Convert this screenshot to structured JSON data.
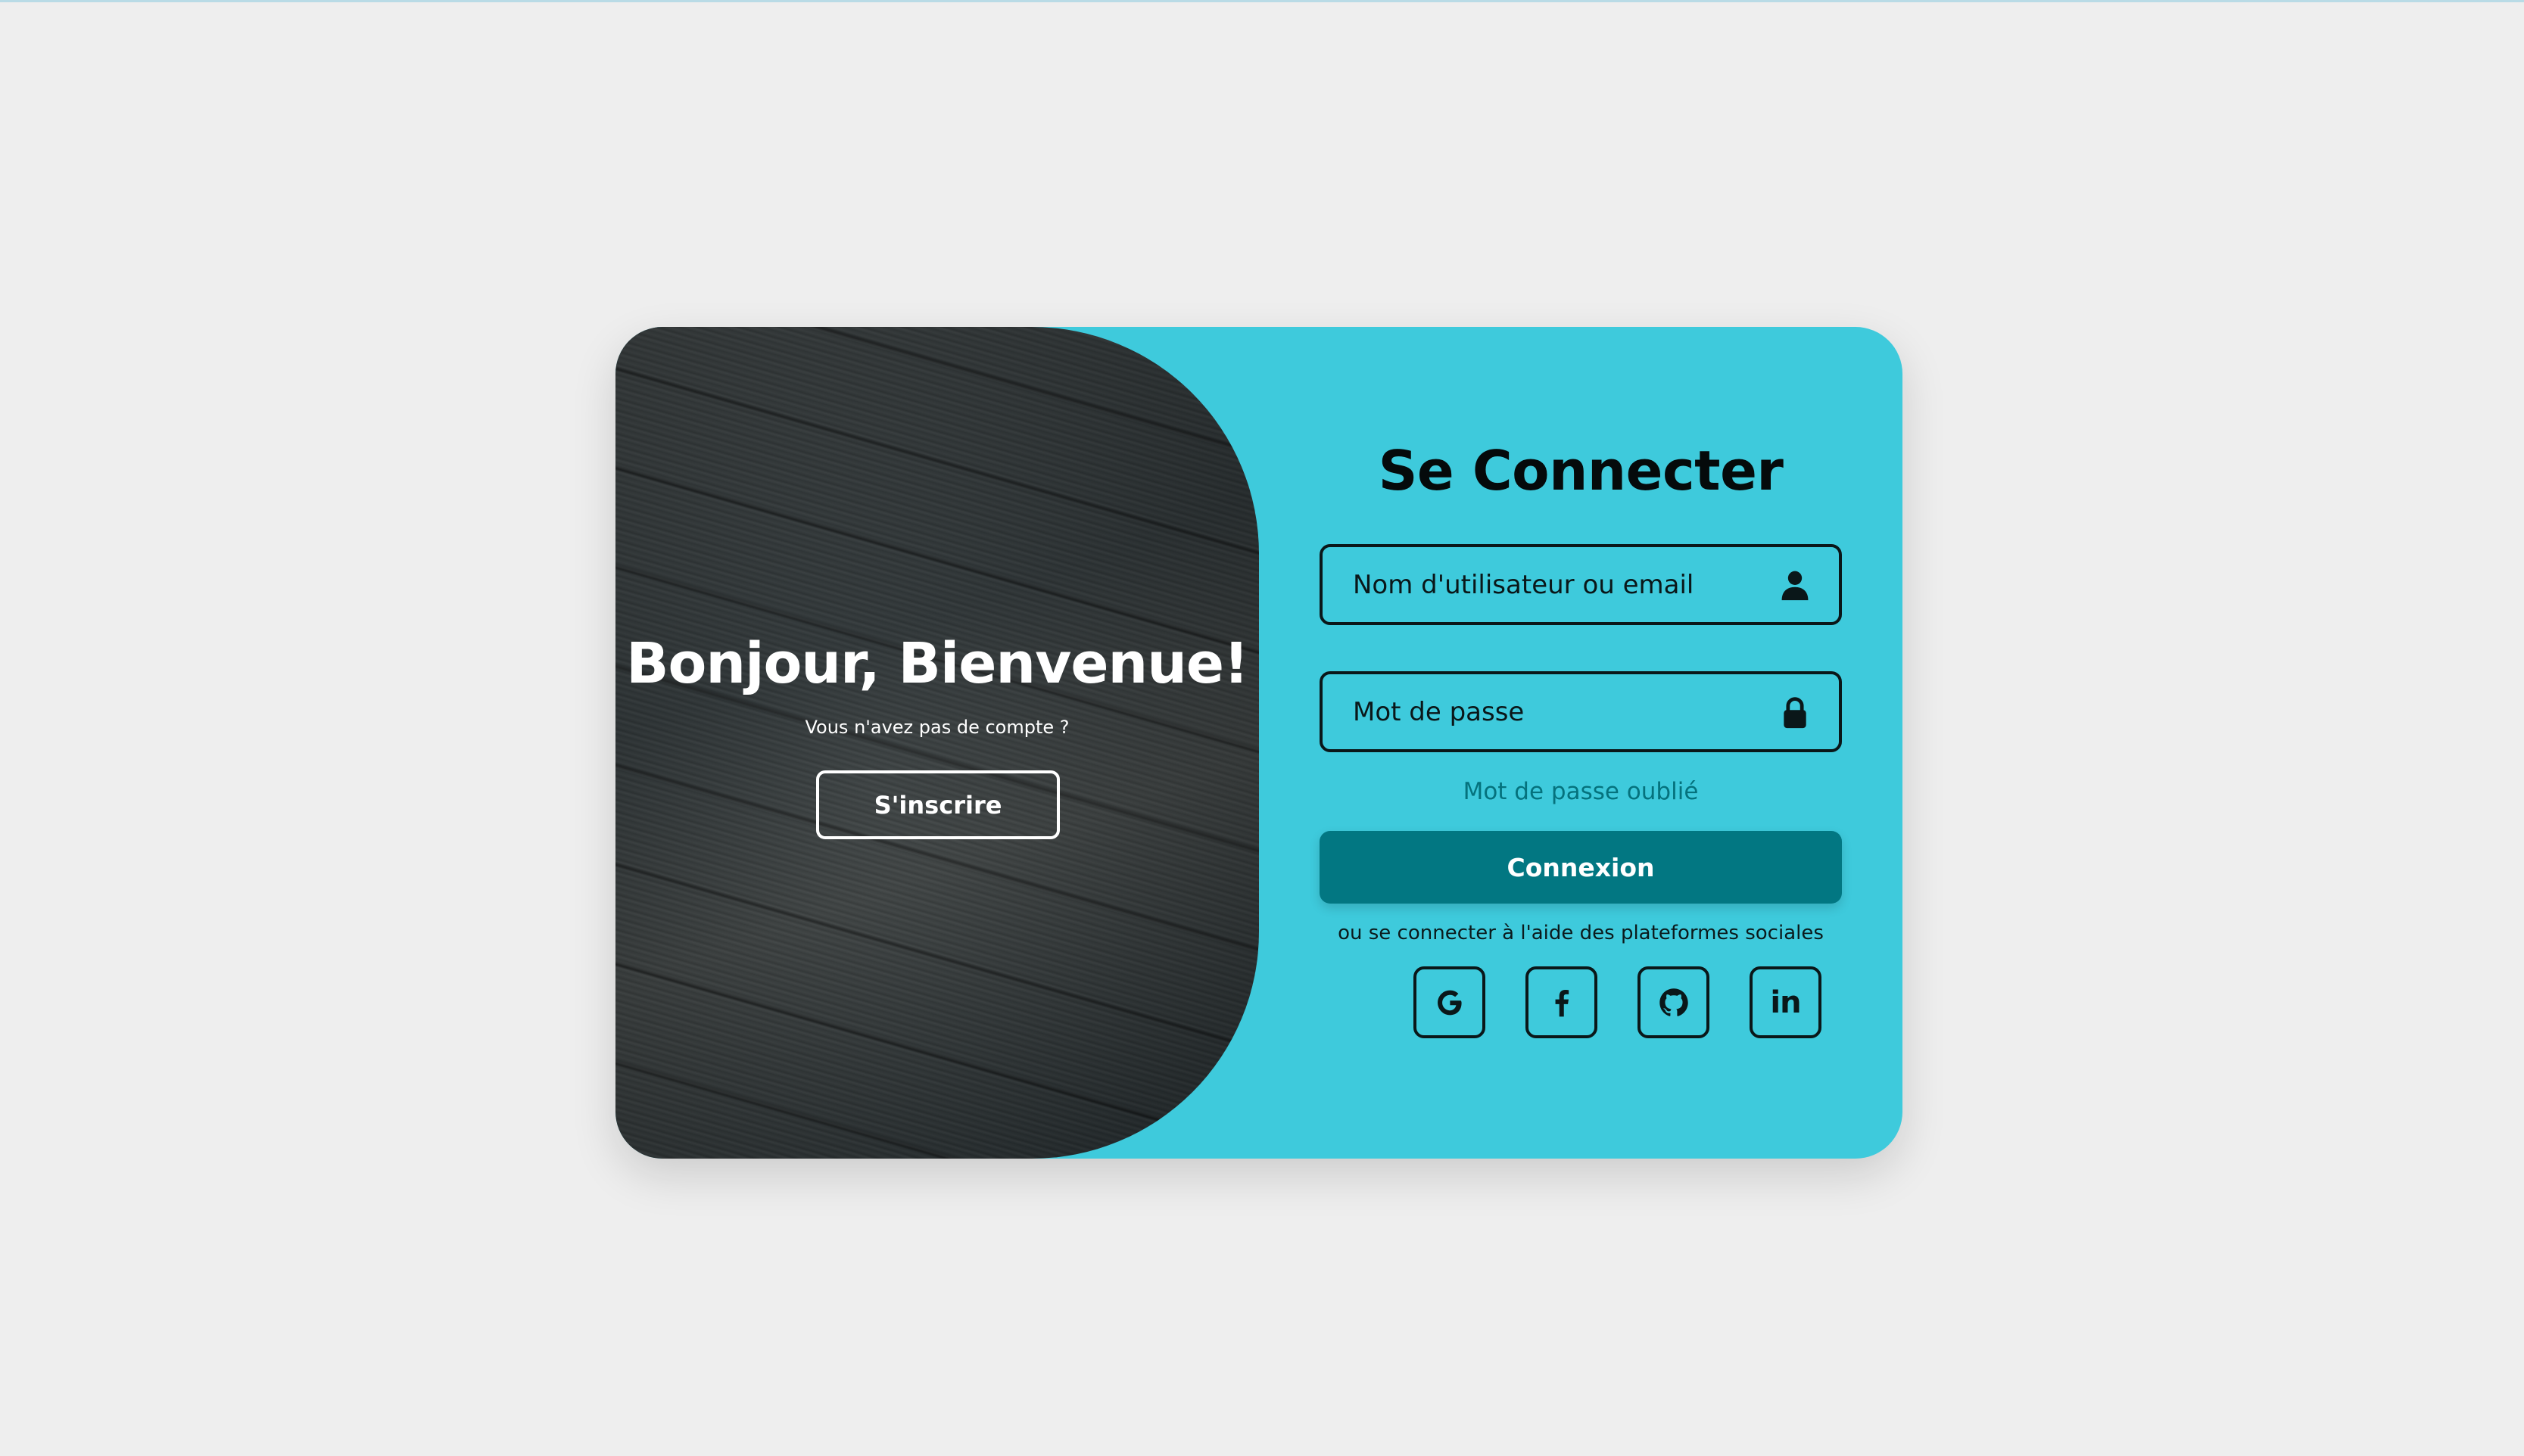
{
  "colors": {
    "page_background": "#eeeeee",
    "card_accent": "#3ecadc",
    "primary_button": "#027782",
    "link": "#05727d",
    "text_dark": "#0a1719",
    "panel_dark": "#343a3c"
  },
  "welcome": {
    "title": "Bonjour, Bienvenue!",
    "subtitle": "Vous n'avez pas de compte ?",
    "signup_label": "S'inscrire"
  },
  "login": {
    "title": "Se Connecter",
    "username_placeholder": "Nom d'utilisateur ou email",
    "username_icon": "user-icon",
    "password_placeholder": "Mot de passe",
    "password_icon": "lock-icon",
    "forgot_label": "Mot de passe oublié",
    "submit_label": "Connexion",
    "social_text": "ou se connecter à l'aide des plateformes sociales",
    "social": [
      {
        "name": "google",
        "icon": "google-icon"
      },
      {
        "name": "facebook",
        "icon": "facebook-icon"
      },
      {
        "name": "github",
        "icon": "github-icon"
      },
      {
        "name": "linkedin",
        "icon": "linkedin-icon",
        "label": "in"
      }
    ]
  }
}
